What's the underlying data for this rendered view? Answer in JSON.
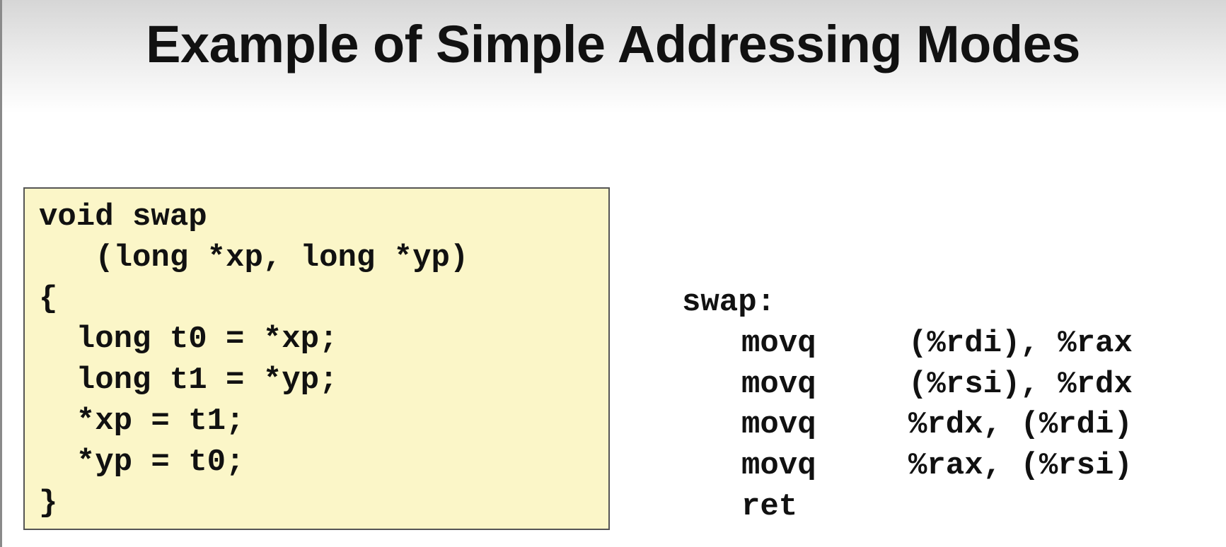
{
  "title": "Example of Simple Addressing Modes",
  "c_code": {
    "lines": [
      "void swap",
      "   (long *xp, long *yp)",
      "{",
      "  long t0 = *xp;",
      "  long t1 = *yp;",
      "  *xp = t1;",
      "  *yp = t0;",
      "}"
    ]
  },
  "assembly": {
    "label": "swap:",
    "instructions": [
      {
        "op": "movq",
        "args": "(%rdi), %rax"
      },
      {
        "op": "movq",
        "args": "(%rsi), %rdx"
      },
      {
        "op": "movq",
        "args": "%rdx, (%rdi)"
      },
      {
        "op": "movq",
        "args": "%rax, (%rsi)"
      },
      {
        "op": "ret",
        "args": ""
      }
    ]
  },
  "colors": {
    "code_box": "#fbf6c8"
  }
}
